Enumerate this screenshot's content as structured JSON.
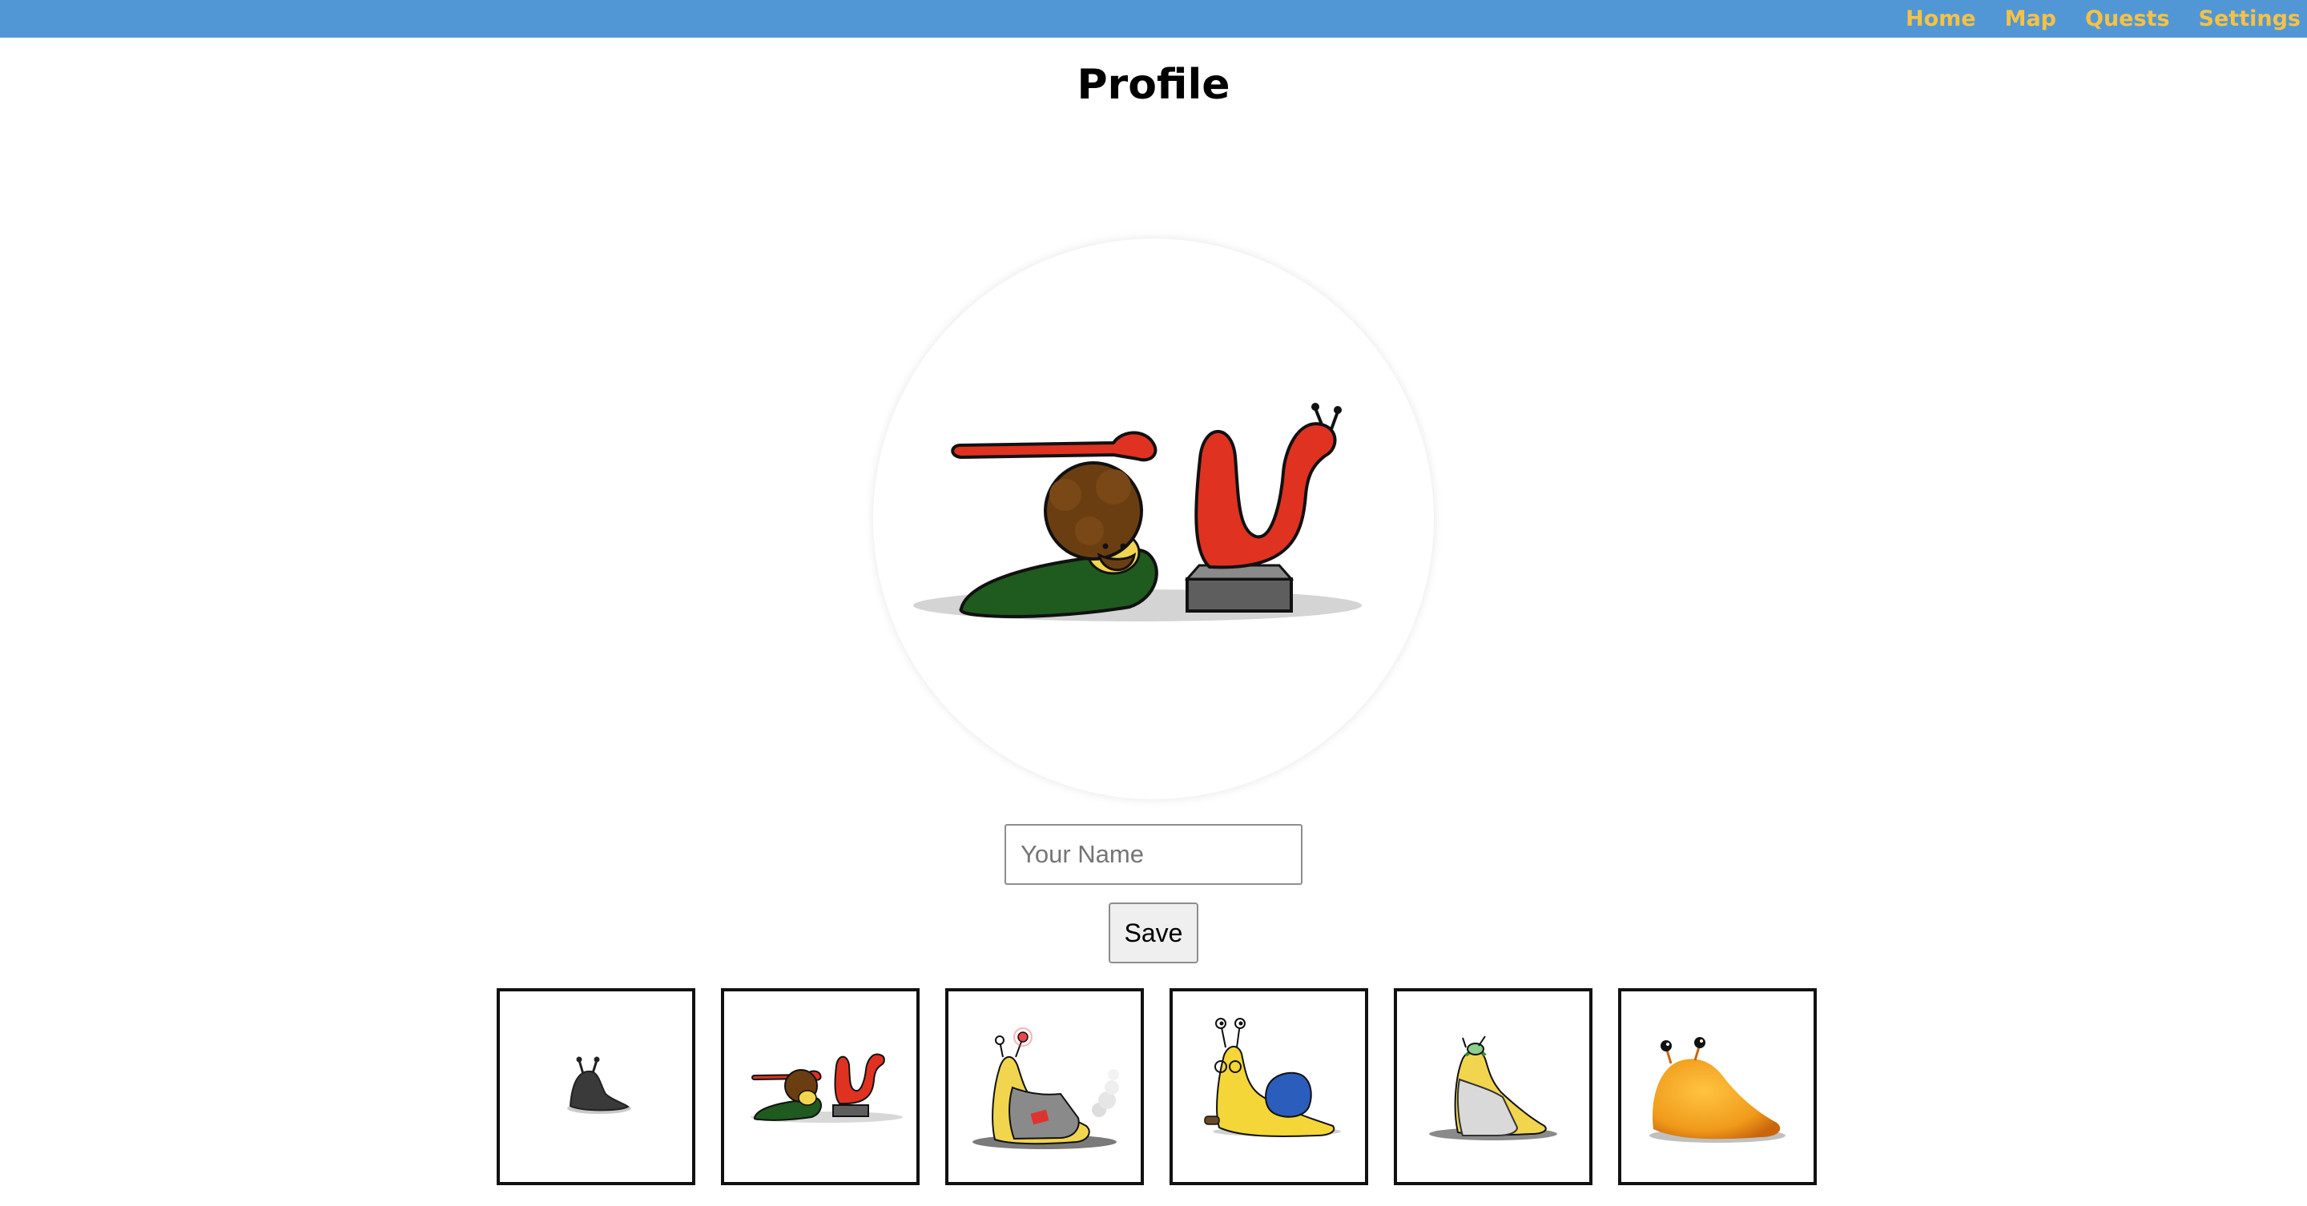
{
  "nav": {
    "home": "Home",
    "map": "Map",
    "quests": "Quests",
    "settings": "Settings"
  },
  "page": {
    "title": "Profile"
  },
  "profile": {
    "selected_avatar": "afro-slug-with-red-sculpture",
    "name_value": "",
    "name_placeholder": "Your Name",
    "save_label": "Save"
  },
  "avatars": [
    {
      "name": "shadow-slug"
    },
    {
      "name": "afro-slug-with-red-sculpture"
    },
    {
      "name": "robot-slug"
    },
    {
      "name": "backpack-slug"
    },
    {
      "name": "lab-coat-slug"
    },
    {
      "name": "orange-slug"
    }
  ],
  "colors": {
    "topbar": "#5297d5",
    "nav_link": "#f6c244"
  }
}
